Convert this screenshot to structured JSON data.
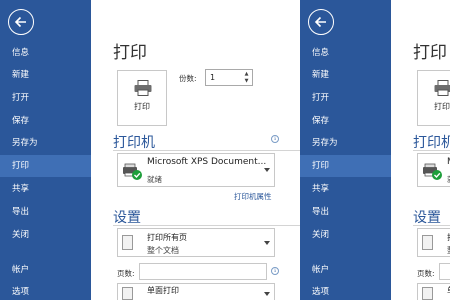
{
  "sidebar": {
    "items": [
      {
        "label": "信息"
      },
      {
        "label": "新建"
      },
      {
        "label": "打开"
      },
      {
        "label": "保存"
      },
      {
        "label": "另存为"
      },
      {
        "label": "打印"
      },
      {
        "label": "共享"
      },
      {
        "label": "导出"
      },
      {
        "label": "关闭"
      },
      {
        "label": "帐户"
      },
      {
        "label": "选项"
      }
    ]
  },
  "main": {
    "title": "打印",
    "print_button_label": "打印",
    "copies_label": "份数:",
    "copies_value": "1",
    "printer_section_title": "打印机",
    "printer_name": "Microsoft XPS Document...",
    "printer_status": "就绪",
    "printer_properties_link": "打印机属性",
    "settings_section_title": "设置",
    "print_range_main": "打印所有页",
    "print_range_sub": "整个文档",
    "pages_label": "页数:",
    "sided_option": "单面打印"
  },
  "colors": {
    "sidebar_bg": "#2b579a",
    "sidebar_active": "#3f6fb5",
    "accent": "#2b579a",
    "status_ok": "#1e9e3a"
  },
  "icons": [
    "back-arrow-icon",
    "printer-icon",
    "printer-ready-icon",
    "info-icon",
    "document-icon",
    "chevron-down-icon"
  ]
}
